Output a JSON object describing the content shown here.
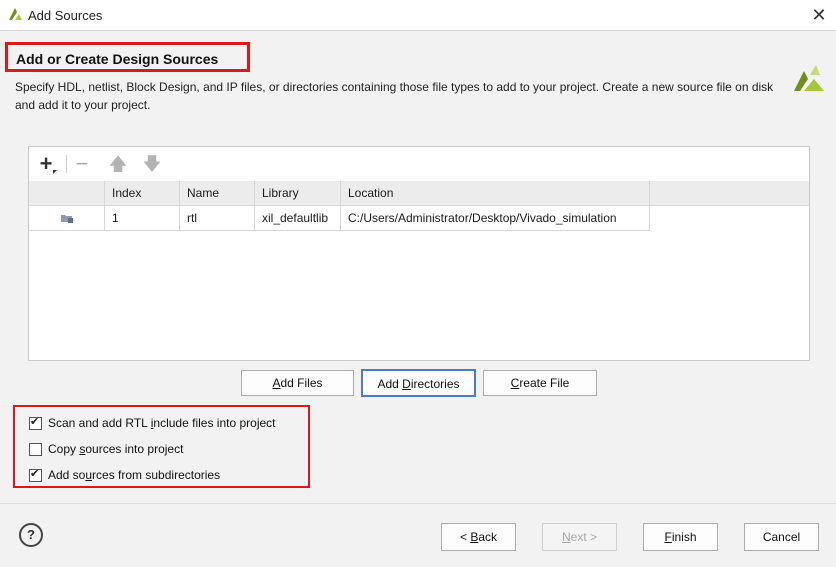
{
  "window": {
    "title": "Add Sources",
    "app_icon": "vivado-logo-icon",
    "close_glyph": "✕"
  },
  "header": {
    "title": "Add or Create Design Sources",
    "description": "Specify HDL, netlist, Block Design, and IP files, or directories containing those file types to add to your project. Create a new source file on disk and add it to your project."
  },
  "toolbar": {
    "add_glyph": "+",
    "remove_glyph": "−",
    "up_glyph": "🡅",
    "down_glyph": "🡇"
  },
  "table": {
    "columns": [
      "",
      "Index",
      "Name",
      "Library",
      "Location"
    ],
    "rows": [
      {
        "icon": "folder-icon",
        "index": "1",
        "name": "rtl",
        "library": "xil_defaultlib",
        "location": "C:/Users/Administrator/Desktop/Vivado_simulation"
      }
    ]
  },
  "actions": {
    "add_files_prefix": "",
    "add_files_key": "A",
    "add_files_rest": "dd Files",
    "add_dirs_prefix": "Add ",
    "add_dirs_key": "D",
    "add_dirs_rest": "irectories",
    "create_prefix": "",
    "create_key": "C",
    "create_rest": "reate File"
  },
  "options": [
    {
      "pre": "Scan and add RTL ",
      "key": "i",
      "post": "nclude files into project",
      "checked": true
    },
    {
      "pre": "Copy ",
      "key": "s",
      "post": "ources into project",
      "checked": false
    },
    {
      "pre": "Add so",
      "key": "u",
      "post": "rces from subdirectories",
      "checked": true
    }
  ],
  "footer": {
    "help_label": "?",
    "back_pre": "< ",
    "back_key": "B",
    "back_rest": "ack",
    "next_pre": "",
    "next_key": "N",
    "next_rest": "ext >",
    "finish_key": "F",
    "finish_rest": "inish",
    "cancel_label": "Cancel"
  },
  "colors": {
    "highlight_red": "#e0161e",
    "focus_blue": "#4a7ec4",
    "logo_green": "#a4c73b"
  }
}
